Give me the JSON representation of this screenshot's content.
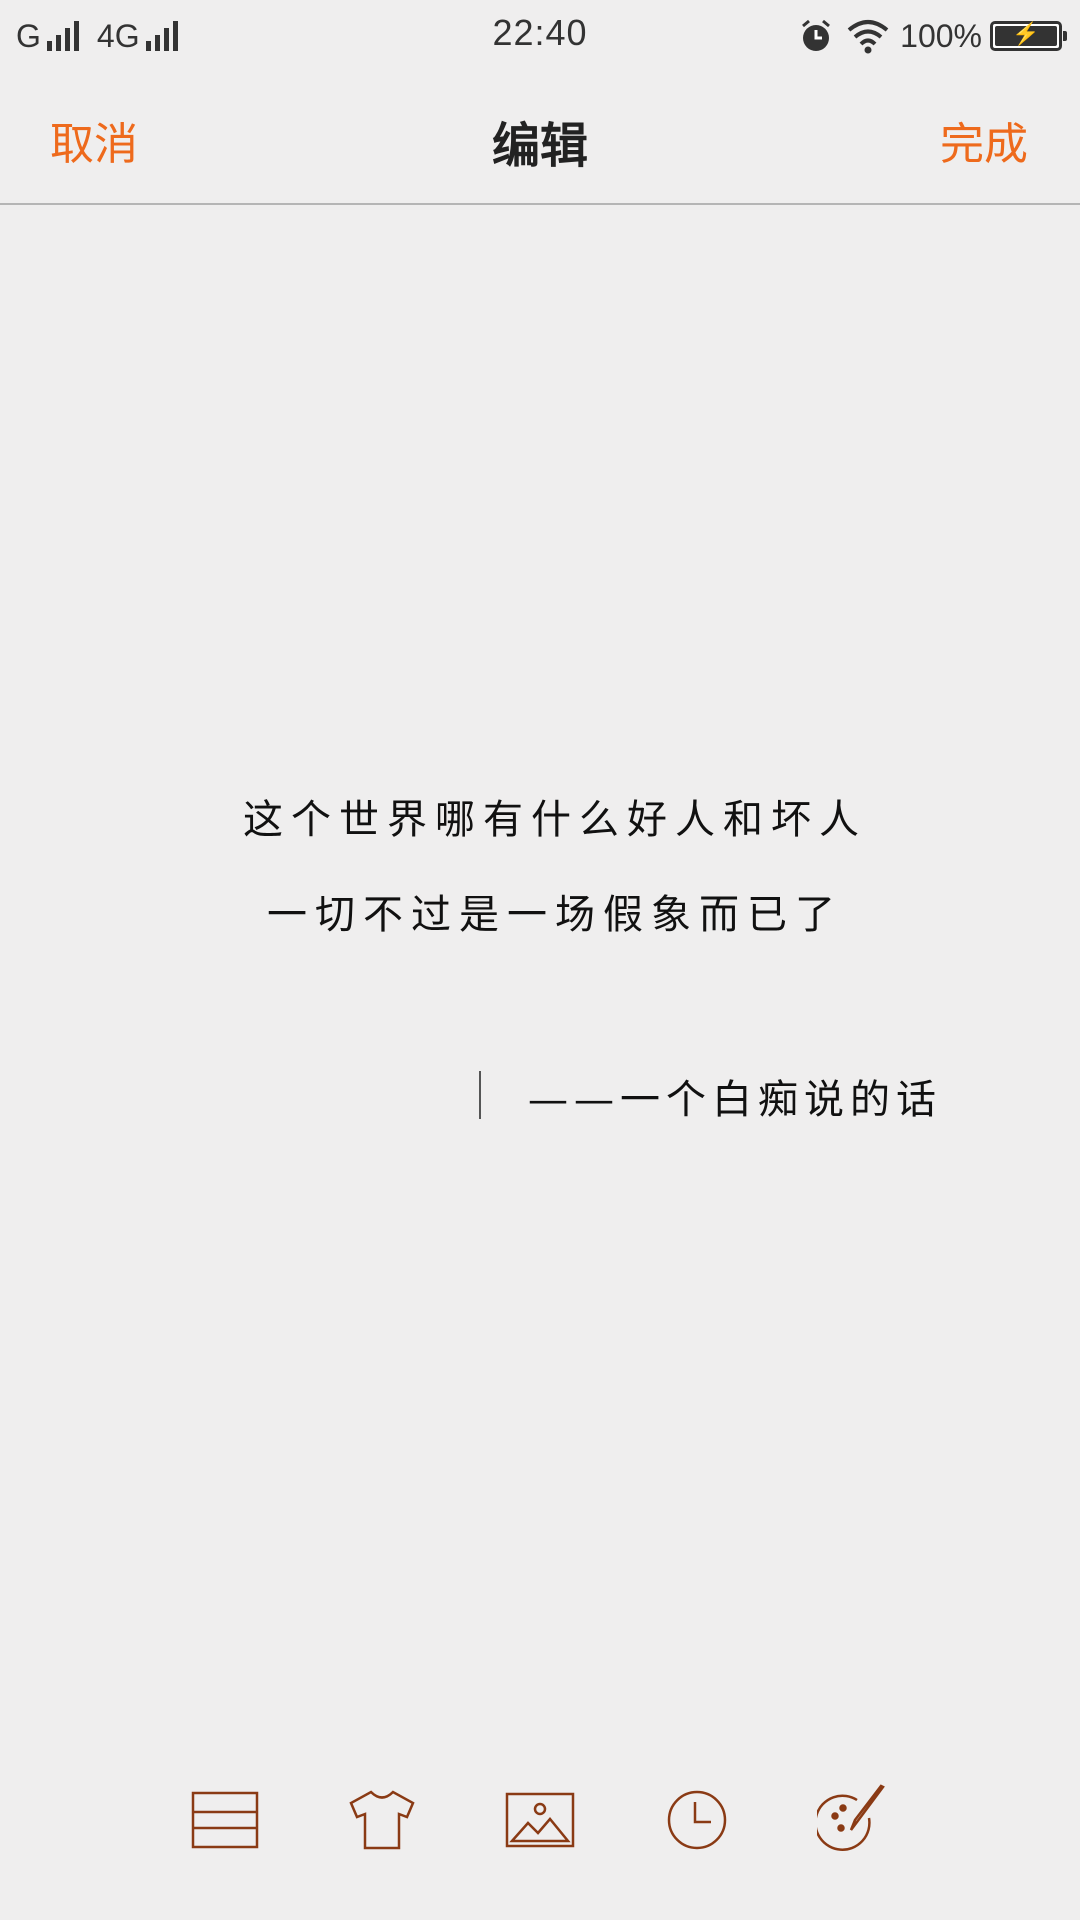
{
  "status_bar": {
    "network1": "G",
    "network2": "4G",
    "time": "22:40",
    "battery_percent": "100%",
    "battery_level": 1.0,
    "icons": [
      "signal-icon",
      "alarm-icon",
      "wifi-icon",
      "battery-charging-icon"
    ]
  },
  "nav": {
    "cancel_label": "取消",
    "title": "编辑",
    "done_label": "完成",
    "accent_color": "#ee6a1c"
  },
  "note": {
    "lines": [
      "这个世界哪有什么好人和坏人",
      "一切不过是一场假象而已了"
    ],
    "signature": "——一个白痴说的话"
  },
  "toolbar": {
    "items": [
      "list-icon",
      "shirt-icon",
      "image-icon",
      "clock-icon",
      "palette-icon"
    ],
    "icon_color": "#8a3a14"
  }
}
